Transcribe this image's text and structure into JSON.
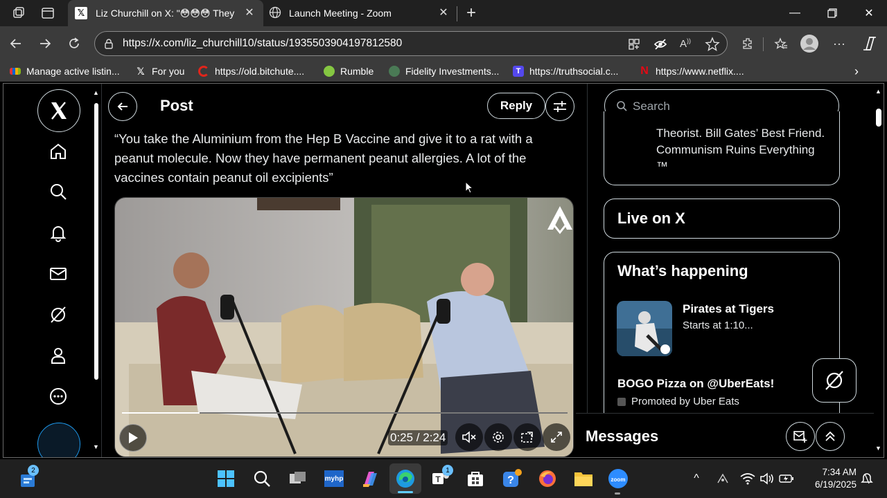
{
  "browser": {
    "tabs": [
      {
        "title": "Liz Churchill on X: \"😳😳😳 They"
      },
      {
        "title": "Launch Meeting - Zoom"
      }
    ],
    "url": "https://x.com/liz_churchill10/status/1935503904197812580",
    "bookmarks": [
      "Manage active listin...",
      "For you",
      "https://old.bitchute....",
      "Rumble",
      "Fidelity Investments...",
      "https://truthsocial.c...",
      "https://www.netflix...."
    ]
  },
  "post": {
    "header_title": "Post",
    "reply_label": "Reply",
    "quote": "“You take the Aluminium from the Hep B Vaccine and give it to a rat with a peanut molecule. Now they have permanent peanut allergies. A lot of the vaccines contain peanut oil excipients”",
    "video": {
      "time": "0:25 / 2:24",
      "progress": 0.174
    }
  },
  "sidebar": {
    "search_placeholder": "Search",
    "bio_snippet": "Theorist. Bill Gates’ Best Friend. Communism Ruins Everything ™",
    "live_title": "Live on X",
    "happening_title": "What’s happening",
    "trends": [
      {
        "title": "Pirates at Tigers",
        "subtitle": "Starts at 1:10..."
      },
      {
        "title": "BOGO Pizza on @UberEats!",
        "subtitle": "Promoted by Uber Eats"
      }
    ],
    "messages_title": "Messages"
  },
  "taskbar": {
    "time": "7:34 AM",
    "date": "6/19/2025",
    "widgets_badge": "2",
    "teams_badge": "1"
  }
}
